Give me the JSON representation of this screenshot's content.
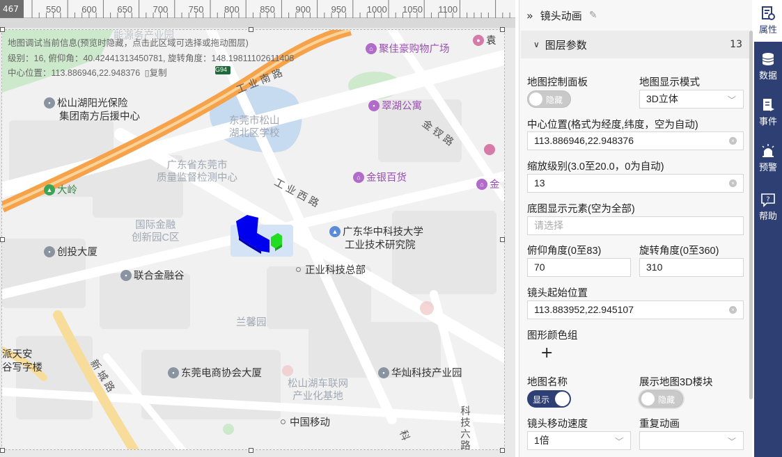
{
  "ruler": {
    "corner": "467",
    "labels": [
      "550",
      "600",
      "650",
      "700",
      "750",
      "800",
      "850",
      "900",
      "950",
      "1000",
      "1050",
      "1100"
    ]
  },
  "map": {
    "debug": {
      "line1": "地图调试当前信息(预览时隐藏，点击此区域可选择或拖动图层)",
      "line2": "级别：16, 俯仰角：40.42441313450781, 旋转角度：148.19811102611408",
      "line3_prefix": "中心位置：113.886946,22.948376",
      "copy": "复制"
    },
    "poi": {
      "mall": "聚佳豪购物广场",
      "insurance_1": "松山湖阳光保险",
      "insurance_2": "集团南方后援中心",
      "cuihu": "翠湖公寓",
      "jinyin": "金银百货",
      "jin_partial": "金",
      "dling": "大岭",
      "research_1": "广东华中科技大学",
      "research_2": "工业技术研究院",
      "chuangtou": "创投大厦",
      "lianhe": "联合金融谷",
      "zhengye": "正业科技总部",
      "pai_1": "派天安",
      "pai_2": "谷写字楼",
      "commerce": "东莞电商协会大厦",
      "huacan": "华灿科技产业园",
      "mobile": "中国移动",
      "yuan_partial": "袁"
    },
    "areas": {
      "school": "东莞市松山\n湖北区学校",
      "inspect": "广东省东莞市\n质量监督检测中心",
      "finance": "国际金融\n创新园C区",
      "lanxin": "兰馨园",
      "carnet": "松山湖车联网\n产业化基地",
      "top_faded": "能源务产业园"
    },
    "roads": {
      "gongye_nan": "工业南路",
      "gongye_xi": "工业西路",
      "jinyin_rd": "金钗路",
      "xincheng": "新城路",
      "keji6": "科技六路",
      "ke": "科",
      "g94": "G94"
    }
  },
  "panel": {
    "title": "镜头动画",
    "section": {
      "name": "图层参数",
      "count": "13"
    },
    "fields": {
      "control_panel_label": "地图控制面板",
      "control_panel_toggle": "隐藏",
      "display_mode_label": "地图显示模式",
      "display_mode_value": "3D立体",
      "center_label": "中心位置(格式为经度,纬度，空为自动)",
      "center_value": "113.886946,22.948376",
      "zoom_label": "缩放级别(3.0至20.0，0为自动)",
      "zoom_value": "13",
      "base_elements_label": "底图显示元素(空为全部)",
      "base_elements_placeholder": "请选择",
      "pitch_label": "俯仰角度(0至83)",
      "pitch_value": "70",
      "rotation_label": "旋转角度(0至360)",
      "rotation_value": "310",
      "start_pos_label": "镜头起始位置",
      "start_pos_value": "113.883952,22.945107",
      "color_group_label": "图形颜色组",
      "add": "+",
      "map_name_label": "地图名称",
      "map_name_toggle": "显示",
      "show_3d_label": "展示地图3D楼块",
      "show_3d_toggle": "隐藏",
      "speed_label": "镜头移动速度",
      "speed_value": "1倍",
      "repeat_label": "重复动画",
      "repeat_value": ""
    }
  },
  "tabs": {
    "properties": "属性",
    "data": "数据",
    "events": "事件",
    "alerts": "预警",
    "help": "帮助"
  },
  "colors": {
    "accent": "#2d3f73",
    "building_blue": "#0000ee",
    "building_green": "#22dd22",
    "highway": "#f5a24a",
    "water": "#c6daf0",
    "park": "#c7e8c6"
  }
}
